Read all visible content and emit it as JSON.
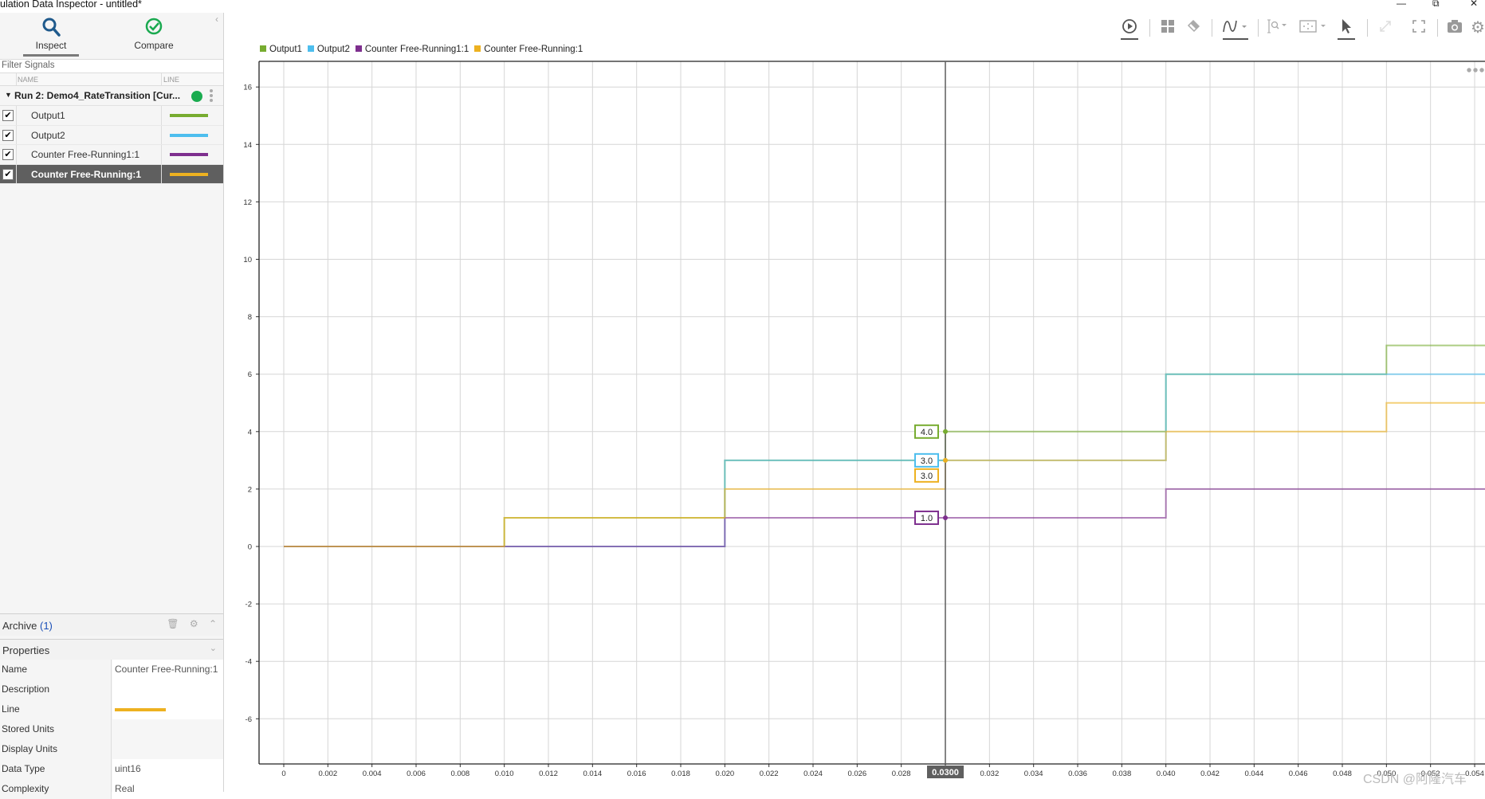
{
  "window": {
    "title": "ulation Data Inspector - untitled*",
    "minimize_icon": "minimize-icon",
    "restore_icon": "restore-icon",
    "close_icon": "close-icon"
  },
  "modes": {
    "inspect": {
      "label": "Inspect",
      "icon": "search-icon",
      "active": true
    },
    "compare": {
      "label": "Compare",
      "icon": "check-circle-icon",
      "active": false
    },
    "collapse_icon": "chevron-left-icon"
  },
  "signals_panel": {
    "filter_placeholder": "Filter Signals",
    "col_name": "NAME",
    "col_line": "LINE",
    "run": {
      "label": "Run 2: Demo4_RateTransition [Cur...",
      "status_color": "#1aab4f",
      "expanded": true
    },
    "signals": [
      {
        "name": "Output1",
        "checked": true,
        "color": "#77ac30",
        "selected": false
      },
      {
        "name": "Output2",
        "checked": true,
        "color": "#4dbeee",
        "selected": false
      },
      {
        "name": "Counter Free-Running1:1",
        "checked": true,
        "color": "#7e2f8e",
        "selected": false
      },
      {
        "name": "Counter Free-Running:1",
        "checked": true,
        "color": "#edb120",
        "selected": true
      }
    ]
  },
  "archive": {
    "label": "Archive",
    "count": "(1)",
    "icons": [
      "trash-icon",
      "gear-icon",
      "chevron-up-icon"
    ]
  },
  "properties": {
    "label": "Properties",
    "rows": [
      {
        "key": "Name",
        "value": "Counter Free-Running:1"
      },
      {
        "key": "Description",
        "value": ""
      },
      {
        "key": "Line",
        "value": "",
        "line_color": "#edb120"
      },
      {
        "key": "Stored Units",
        "value": ""
      },
      {
        "key": "Display Units",
        "value": ""
      },
      {
        "key": "Data Type",
        "value": "uint16"
      },
      {
        "key": "Complexity",
        "value": "Real"
      }
    ]
  },
  "toolbar": {
    "buttons": [
      {
        "name": "replay-button",
        "icon": "play-circle-icon",
        "active": true
      },
      {
        "name": "layout-button",
        "icon": "grid-icon",
        "active": false
      },
      {
        "name": "clear-button",
        "icon": "eraser-icon",
        "active": false
      },
      {
        "name": "signal-style-button",
        "icon": "waveform-icon",
        "active": true,
        "dropdown": true
      },
      {
        "name": "zoom-button",
        "icon": "zoom-icon",
        "active": false,
        "dropdown": true
      },
      {
        "name": "fit-button",
        "icon": "fit-to-view-icon",
        "active": false,
        "dropdown": true
      },
      {
        "name": "cursor-button",
        "icon": "cursor-icon",
        "active": true
      },
      {
        "name": "expand-button",
        "icon": "expand-icon",
        "active": false,
        "disabled": true
      },
      {
        "name": "fullscreen-button",
        "icon": "fullscreen-icon",
        "active": false
      },
      {
        "name": "snapshot-button",
        "icon": "camera-icon",
        "active": false
      },
      {
        "name": "settings-button",
        "icon": "gear-icon",
        "active": false
      }
    ]
  },
  "cursor": {
    "time_label": "0.0300",
    "time": 0.03
  },
  "watermark": "CSDN @阿隆汽车",
  "more_icon": "more-horizontal-icon",
  "chart_data": {
    "type": "line",
    "step": true,
    "title": "",
    "xlabel": "",
    "ylabel": "",
    "xlim": [
      -0.0011,
      0.0545
    ],
    "ylim": [
      -7.6,
      16.9
    ],
    "grid": true,
    "legend_position": "top-left",
    "x_ticks": [
      "0",
      "0.002",
      "0.004",
      "0.006",
      "0.008",
      "0.010",
      "0.012",
      "0.014",
      "0.016",
      "0.018",
      "0.020",
      "0.022",
      "0.024",
      "0.026",
      "0.028",
      "0.030",
      "0.032",
      "0.034",
      "0.036",
      "0.038",
      "0.040",
      "0.042",
      "0.044",
      "0.046",
      "0.048",
      "0.050",
      "0.052",
      "0.054"
    ],
    "y_ticks": [
      "16",
      "14",
      "12",
      "10",
      "8",
      "6",
      "4",
      "2",
      "0",
      "-2",
      "-4",
      "-6"
    ],
    "x": [
      0,
      0.01,
      0.02,
      0.03,
      0.04,
      0.05
    ],
    "series": [
      {
        "name": "Output1",
        "color": "#77ac30",
        "values": [
          0,
          1,
          3,
          4,
          6,
          7
        ],
        "cursor_value": "4.0"
      },
      {
        "name": "Output2",
        "color": "#4dbeee",
        "values": [
          0,
          0,
          3,
          3,
          6,
          6
        ],
        "cursor_value": "3.0"
      },
      {
        "name": "Counter Free-Running1:1",
        "color": "#7e2f8e",
        "values": [
          0,
          0,
          1,
          1,
          2,
          2
        ],
        "cursor_value": "1.0"
      },
      {
        "name": "Counter Free-Running:1",
        "color": "#edb120",
        "values": [
          0,
          1,
          2,
          3,
          4,
          5
        ],
        "cursor_value": "3.0"
      }
    ]
  }
}
